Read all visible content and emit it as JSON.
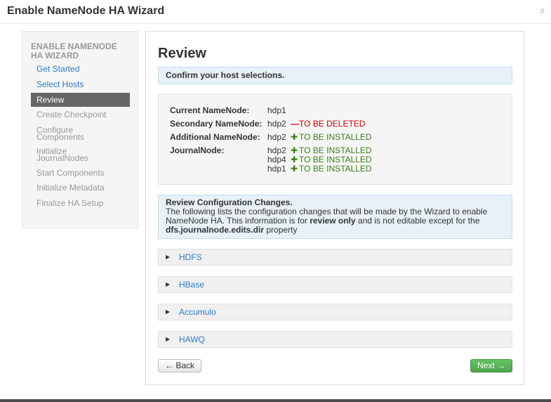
{
  "modal": {
    "title": "Enable NameNode HA Wizard",
    "close_label": "x"
  },
  "sidebar": {
    "title": "ENABLE NAMENODE HA WIZARD",
    "items": [
      {
        "label": "Get Started",
        "state": "done"
      },
      {
        "label": "Select Hosts",
        "state": "done"
      },
      {
        "label": "Review",
        "state": "active"
      },
      {
        "label": "Create Checkpoint",
        "state": "todo"
      },
      {
        "label": "Configure Components",
        "state": "todo"
      },
      {
        "label": "Initialize JournalNodes",
        "state": "todo"
      },
      {
        "label": "Start Components",
        "state": "todo"
      },
      {
        "label": "Initialize Metadata",
        "state": "todo"
      },
      {
        "label": "Finalize HA Setup",
        "state": "todo"
      }
    ]
  },
  "main": {
    "title": "Review",
    "confirm_text": "Confirm your host selections.",
    "hosts": {
      "current_namenode": {
        "label": "Current NameNode:",
        "host": "hdp1"
      },
      "secondary_namenode": {
        "label": "Secondary NameNode:",
        "host": "hdp2",
        "status": "TO BE DELETED",
        "symbol": "—"
      },
      "additional_namenode": {
        "label": "Additional NameNode:",
        "host": "hdp2",
        "status": "TO BE INSTALLED",
        "symbol": "✚"
      },
      "journalnode": {
        "label": "JournalNode:",
        "entries": [
          {
            "host": "hdp2",
            "status": "TO BE INSTALLED",
            "symbol": "✚"
          },
          {
            "host": "hdp4",
            "status": "TO BE INSTALLED",
            "symbol": "✚"
          },
          {
            "host": "hdp1",
            "status": "TO BE INSTALLED",
            "symbol": "✚"
          }
        ]
      }
    },
    "review_config": {
      "heading": "Review Configuration Changes.",
      "text_1": "The following lists the configuration changes that will be made by the Wizard to enable NameNode HA. This information is for ",
      "text_bold_1": "review only",
      "text_2": " and is not editable except for the ",
      "text_bold_2": "dfs.journalnode.edits.dir",
      "text_3": " property"
    },
    "services": [
      {
        "name": "HDFS"
      },
      {
        "name": "HBase"
      },
      {
        "name": "Accumulo"
      },
      {
        "name": "HAWQ"
      }
    ],
    "buttons": {
      "back": "← Back",
      "next": "Next →"
    }
  },
  "colors": {
    "link": "#2e7bc4",
    "deleted": "#cc0000",
    "installed": "#3a7f1a",
    "next_button": "#5bb75b",
    "active_nav": "#666666"
  },
  "icons": {
    "caret": "caret-right-icon",
    "minus": "minus-icon",
    "plus": "plus-icon"
  }
}
